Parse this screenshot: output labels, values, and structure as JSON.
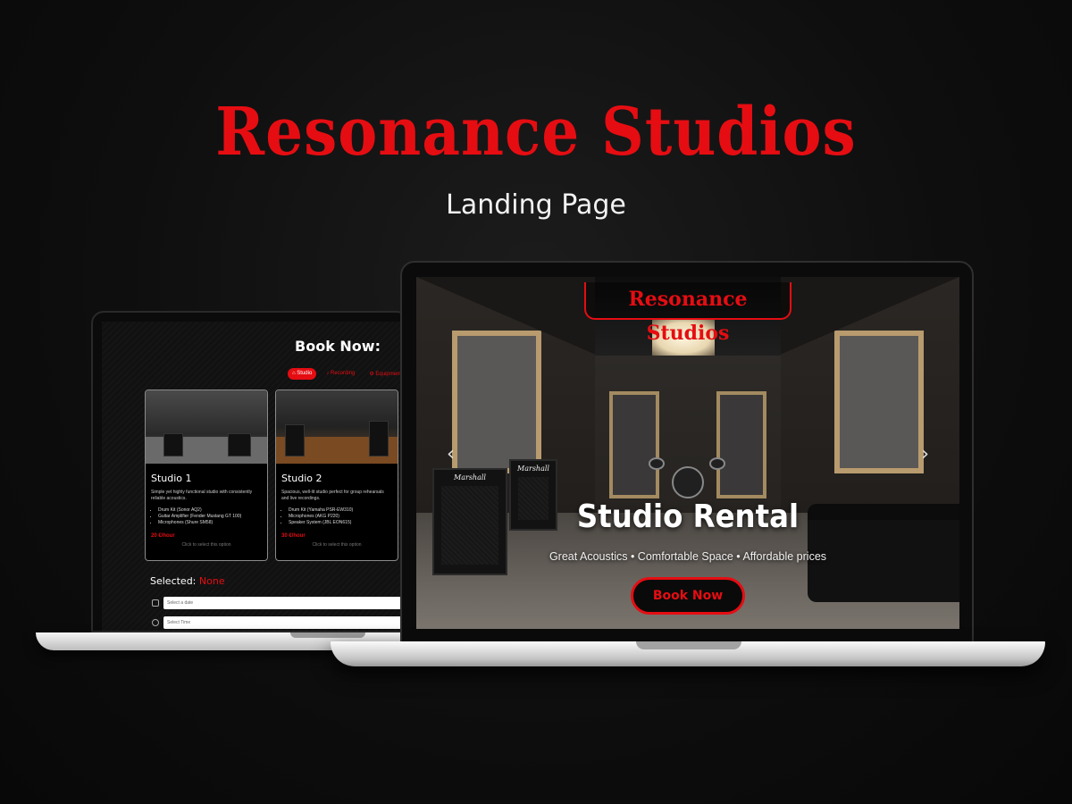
{
  "header": {
    "brand": "Resonance Studios",
    "subtitle": "Landing Page"
  },
  "booking": {
    "title": "Book Now:",
    "tabs": [
      {
        "label": "Studio",
        "active": true
      },
      {
        "label": "Recording",
        "active": false
      },
      {
        "label": "Equipment",
        "active": false
      }
    ],
    "cards": [
      {
        "name": "Studio 1",
        "description": "Simple yet highly functional studio with consistently reliable acoustics.",
        "equipment": [
          "Drum Kit (Sonor AQ2)",
          "Guitar Amplifier (Fender Mustang GT 100)",
          "Microphones (Shure SM58)"
        ],
        "price": "20 €/hour",
        "hint": "Click to select this option"
      },
      {
        "name": "Studio 2",
        "description": "Spacious, well-lit studio perfect for group rehearsals and live recordings.",
        "equipment": [
          "Drum Kit (Yamaha PSR-EW310)",
          "Microphones (AKG P220)",
          "Speaker System (JBL EON615)"
        ],
        "price": "30 €/hour",
        "hint": "Click to select this option"
      }
    ],
    "selected_label": "Selected:",
    "selected_value": "None",
    "date_placeholder": "Select a date",
    "time_placeholder": "Select Time"
  },
  "hero": {
    "logo": "Resonance Studios",
    "title": "Studio Rental",
    "tagline": "Great Acoustics • Comfortable Space • Affordable prices",
    "button": "Book Now",
    "prev_icon": "chevron-left-icon",
    "next_icon": "chevron-right-icon",
    "amp_brand": "Marshall"
  },
  "colors": {
    "accent": "#e50d12",
    "background": "#0e0e0e",
    "text": "#ffffff"
  }
}
